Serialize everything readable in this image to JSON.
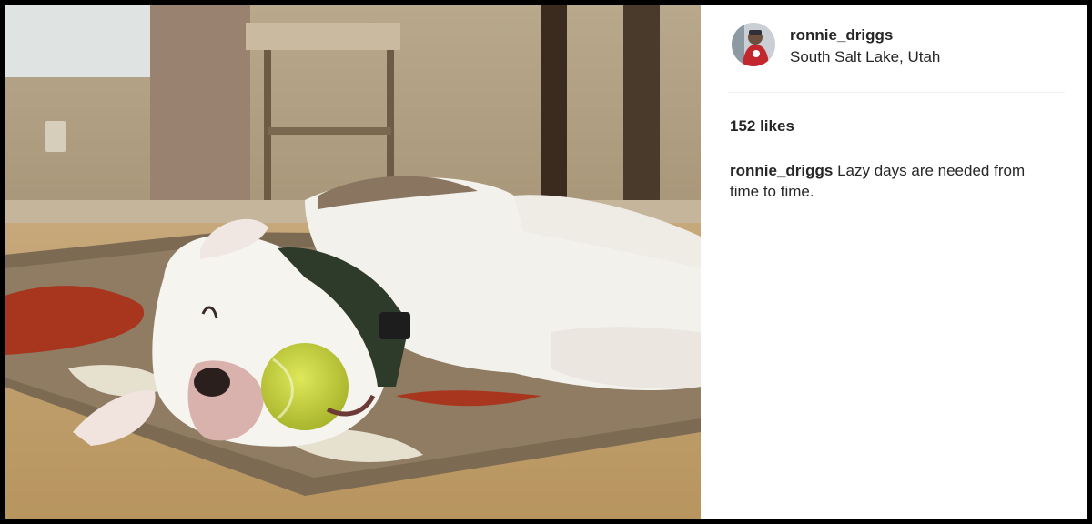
{
  "post": {
    "username": "ronnie_driggs",
    "location": "South Salt Lake, Utah",
    "likes": "152 likes",
    "caption": {
      "username": "ronnie_driggs",
      "text": "Lazy days are needed from time to time."
    }
  },
  "photo": {
    "subject": "sleeping dog with tennis ball on rug"
  },
  "colors": {
    "text": "#262626",
    "divider": "#efefef",
    "frame": "#000000"
  }
}
